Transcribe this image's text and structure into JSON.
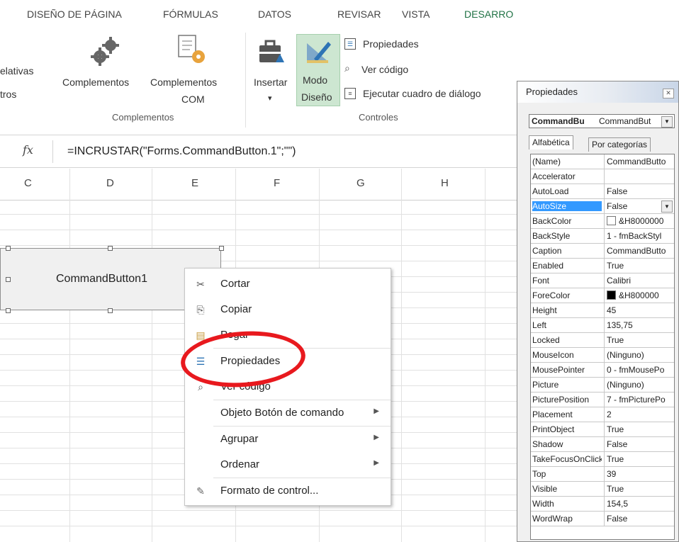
{
  "ribbon_tabs": [
    "DISEÑO DE PÁGINA",
    "FÓRMULAS",
    "DATOS",
    "REVISAR",
    "VISTA",
    "DESARRO"
  ],
  "ribbon": {
    "cut_left": {
      "line1": "elativas",
      "line2": "tros"
    },
    "complementos": {
      "label": "Complementos",
      "icon": "gears-icon"
    },
    "complementos_com": {
      "line1": "Complementos",
      "line2": "COM",
      "icon": "com-addin-icon"
    },
    "group_complementos": "Complementos",
    "insertar": {
      "label": "Insertar",
      "dropdown": "▾",
      "icon": "toolbox-icon"
    },
    "modo_diseno": {
      "line1": "Modo",
      "line2": "Diseño",
      "icon": "design-mode-icon",
      "active": true
    },
    "propiedades": "Propiedades",
    "ver_codigo": "Ver código",
    "ejecutar": "Ejecutar cuadro de diálogo",
    "group_controles": "Controles"
  },
  "formula_bar": {
    "fx": "fx",
    "formula": "=INCRUSTAR(\"Forms.CommandButton.1\";\"\")"
  },
  "columns": [
    "C",
    "D",
    "E",
    "F",
    "G",
    "H"
  ],
  "command_button": {
    "caption": "CommandButton1"
  },
  "context_menu": {
    "items": [
      {
        "label": "Cortar",
        "icon": "scissors-icon"
      },
      {
        "label": "Copiar",
        "icon": "copy-icon"
      },
      {
        "label": "Pegar",
        "icon": "paste-icon"
      },
      {
        "label": "Propiedades",
        "icon": "properties-icon",
        "highlighted_by_annotation": true
      },
      {
        "label": "Ver código",
        "icon": "view-code-icon"
      },
      {
        "label": "Objeto Botón de comando",
        "submenu": true
      },
      {
        "label": "Agrupar",
        "submenu": true
      },
      {
        "label": "Ordenar",
        "submenu": true
      },
      {
        "label": "Formato de control...",
        "icon": "format-control-icon"
      }
    ],
    "annotation_color": "#e8191e"
  },
  "properties_window": {
    "title": "Propiedades",
    "object_name": "CommandBu",
    "object_type": "CommandBut",
    "tabs": [
      "Alfabética",
      "Por categorías"
    ],
    "rows": [
      {
        "name": "(Name)",
        "value": "CommandButto"
      },
      {
        "name": "Accelerator",
        "value": ""
      },
      {
        "name": "AutoLoad",
        "value": "False"
      },
      {
        "name": "AutoSize",
        "value": "False",
        "selected": true
      },
      {
        "name": "BackColor",
        "value": "&H8000000",
        "swatch": "#ffffff"
      },
      {
        "name": "BackStyle",
        "value": "1 - fmBackStyl"
      },
      {
        "name": "Caption",
        "value": "CommandButto"
      },
      {
        "name": "Enabled",
        "value": "True"
      },
      {
        "name": "Font",
        "value": "Calibri"
      },
      {
        "name": "ForeColor",
        "value": "&H800000",
        "swatch": "#000000"
      },
      {
        "name": "Height",
        "value": "45"
      },
      {
        "name": "Left",
        "value": "135,75"
      },
      {
        "name": "Locked",
        "value": "True"
      },
      {
        "name": "MouseIcon",
        "value": "(Ninguno)"
      },
      {
        "name": "MousePointer",
        "value": "0 - fmMousePo"
      },
      {
        "name": "Picture",
        "value": "(Ninguno)"
      },
      {
        "name": "PicturePosition",
        "value": "7 - fmPicturePo"
      },
      {
        "name": "Placement",
        "value": "2"
      },
      {
        "name": "PrintObject",
        "value": "True"
      },
      {
        "name": "Shadow",
        "value": "False"
      },
      {
        "name": "TakeFocusOnClick",
        "value": "True"
      },
      {
        "name": "Top",
        "value": "39"
      },
      {
        "name": "Visible",
        "value": "True"
      },
      {
        "name": "Width",
        "value": "154,5"
      },
      {
        "name": "WordWrap",
        "value": "False"
      }
    ]
  },
  "colors": {
    "accent_green": "#217346",
    "selection_blue": "#3399ff",
    "modo_bg": "#cde6d1"
  }
}
